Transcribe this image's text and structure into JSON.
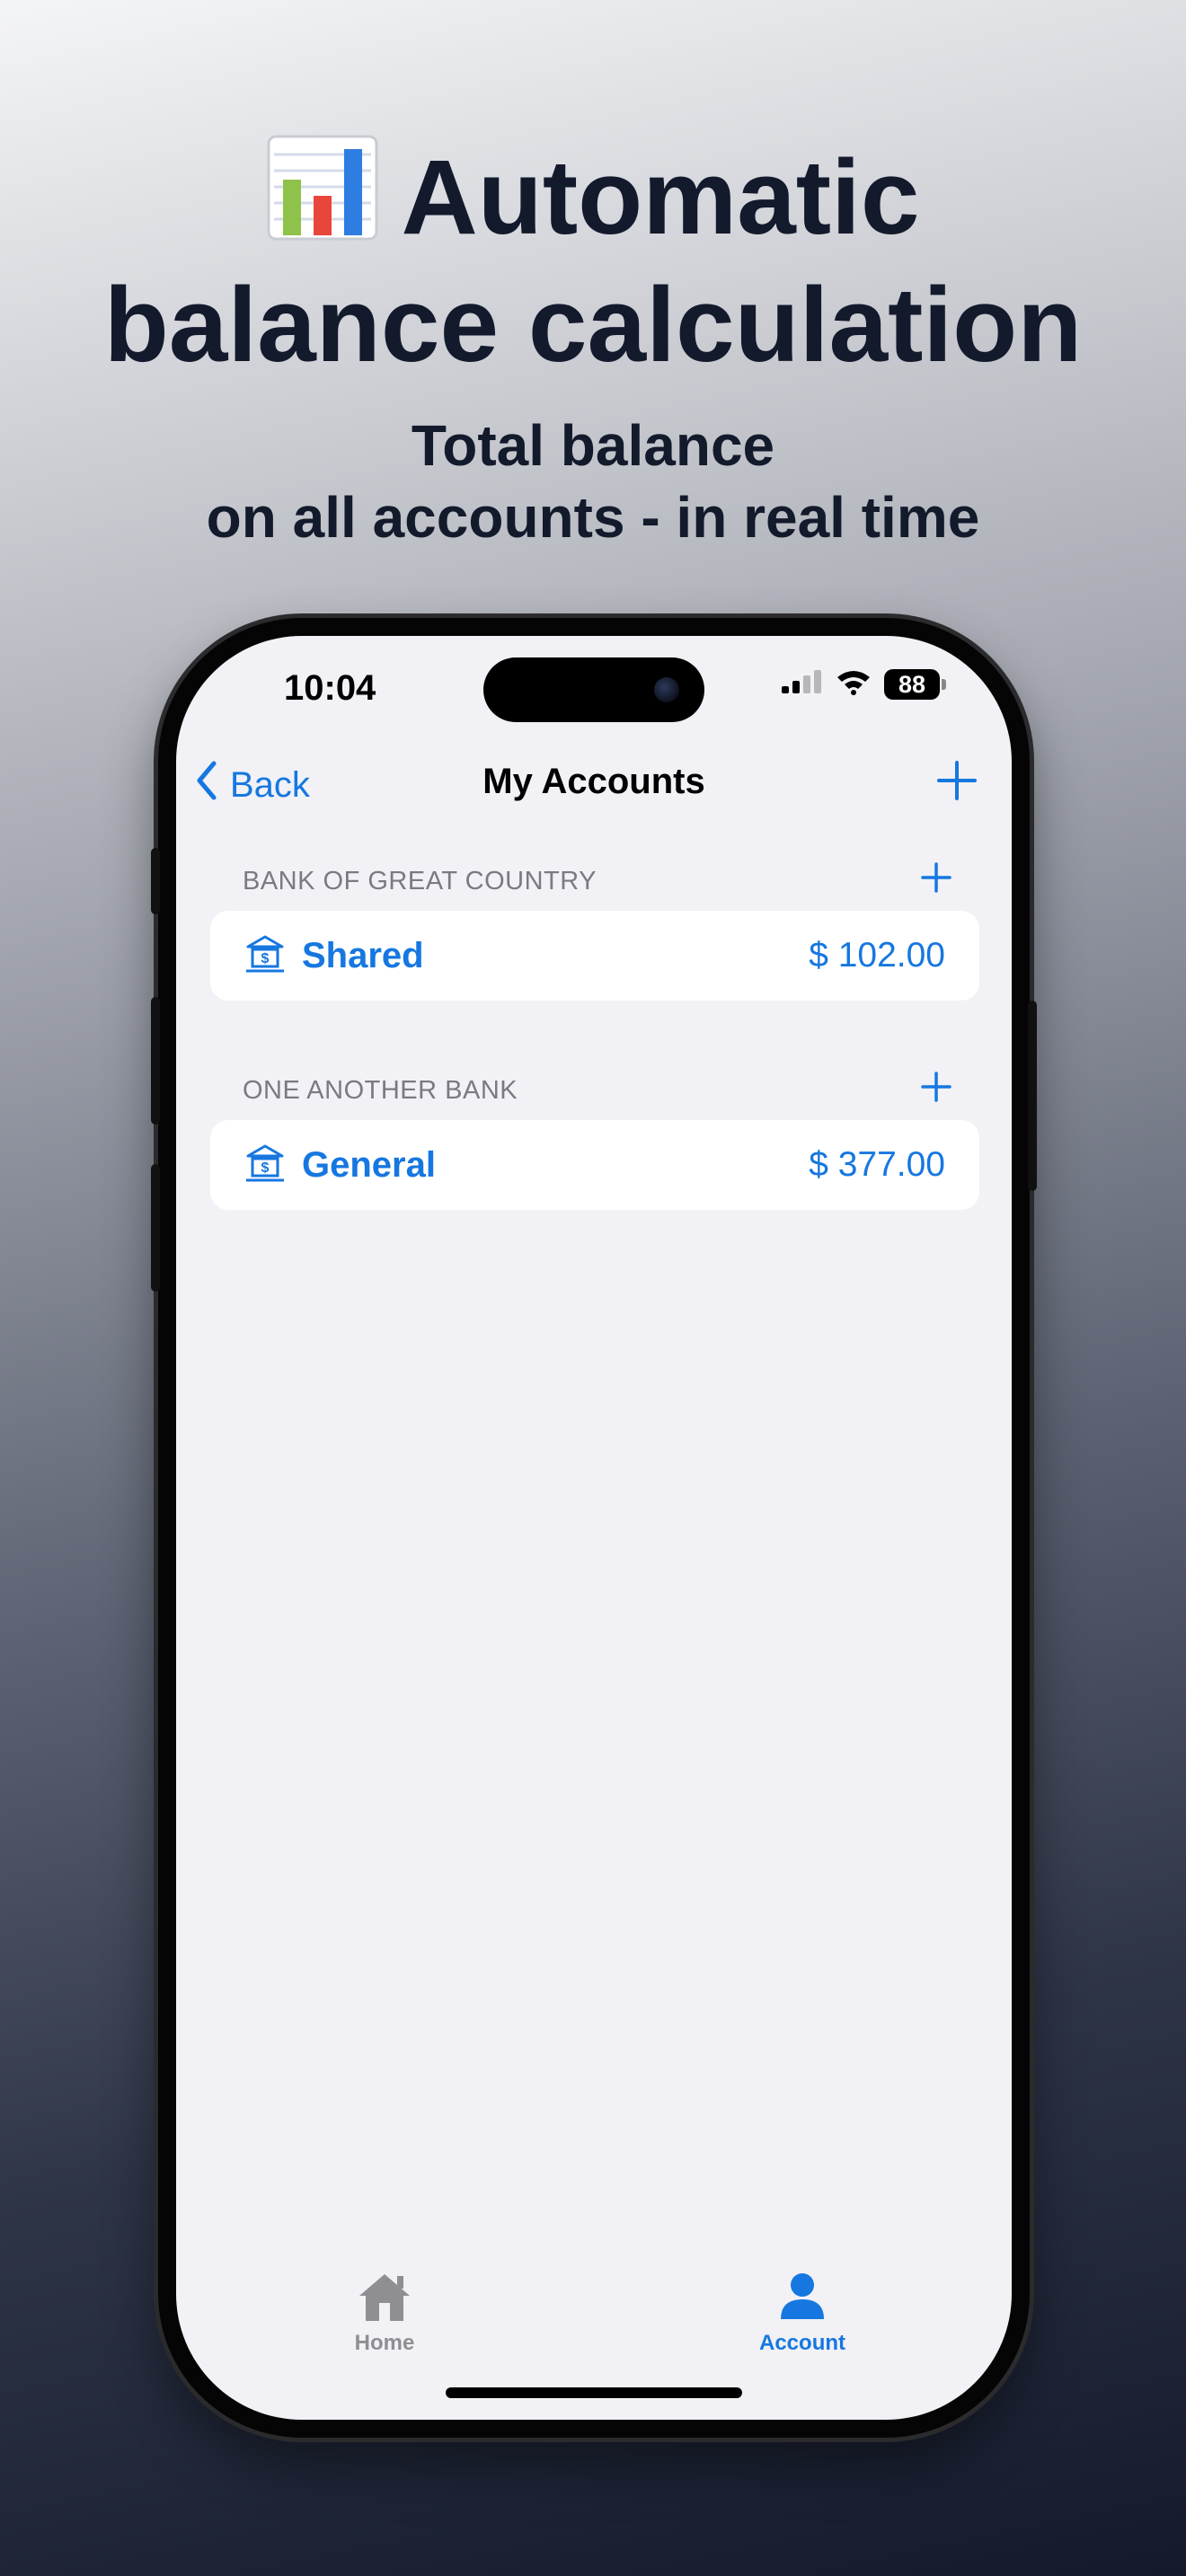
{
  "promo": {
    "title_line1": "Automatic",
    "title_line2": "balance calculation",
    "subtitle_line1": "Total balance",
    "subtitle_line2": "on all accounts - in real time",
    "title_icon": "bar-chart-emoji-icon"
  },
  "status_bar": {
    "time": "10:04",
    "battery": "88",
    "icons": [
      "cellular-signal-icon",
      "wifi-icon",
      "battery-icon"
    ]
  },
  "nav": {
    "back_label": "Back",
    "title": "My Accounts",
    "icons": [
      "chevron-left-icon",
      "plus-icon"
    ]
  },
  "sections": [
    {
      "header": "BANK OF GREAT COUNTRY",
      "accounts": [
        {
          "name": "Shared",
          "amount": "$ 102.00",
          "icon": "bank-icon"
        }
      ]
    },
    {
      "header": "ONE ANOTHER BANK",
      "accounts": [
        {
          "name": "General",
          "amount": "$ 377.00",
          "icon": "bank-icon"
        }
      ]
    }
  ],
  "tabs": [
    {
      "label": "Home",
      "icon": "house-icon",
      "active": false
    },
    {
      "label": "Account",
      "icon": "person-icon",
      "active": true
    }
  ],
  "colors": {
    "accent": "#1677e0",
    "inactive_tab": "#8e8e93",
    "screen_background": "#f1f1f6",
    "headline_text": "#131a2c"
  }
}
